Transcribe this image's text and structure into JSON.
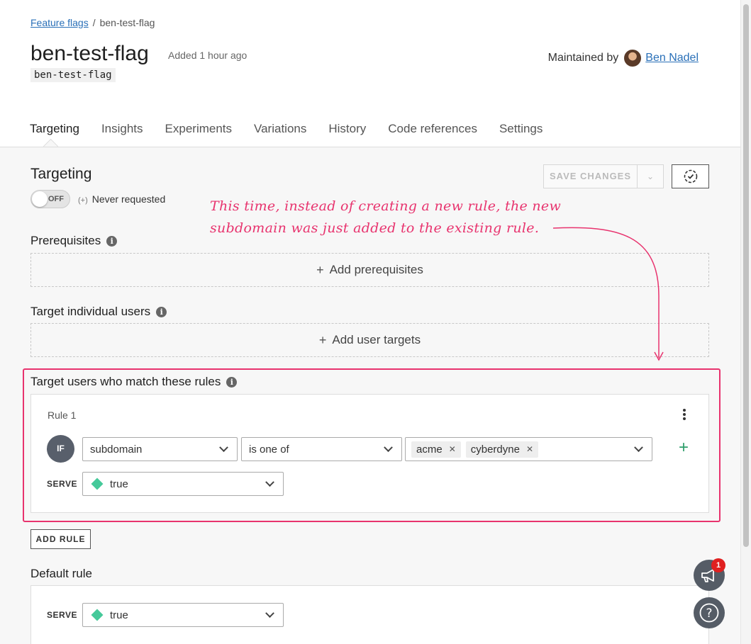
{
  "breadcrumb": {
    "parent": "Feature flags",
    "separator": "/",
    "current": "ben-test-flag"
  },
  "flag": {
    "name": "ben-test-flag",
    "added": "Added 1 hour ago",
    "key": "ben-test-flag"
  },
  "maintainer": {
    "prefix": "Maintained by",
    "name": "Ben Nadel"
  },
  "tabs": [
    {
      "label": "Targeting",
      "active": true
    },
    {
      "label": "Insights"
    },
    {
      "label": "Experiments"
    },
    {
      "label": "Variations"
    },
    {
      "label": "History"
    },
    {
      "label": "Code references"
    },
    {
      "label": "Settings"
    }
  ],
  "targeting": {
    "title": "Targeting",
    "toggle_label": "OFF",
    "toggle_on": false,
    "requested_plus": "(+)",
    "requested_text": "Never requested",
    "save_label": "SAVE CHANGES"
  },
  "prerequisites": {
    "title": "Prerequisites",
    "add_label": "Add prerequisites"
  },
  "individual": {
    "title": "Target individual users",
    "add_label": "Add user targets"
  },
  "rules": {
    "title": "Target users who match these rules",
    "rule_name": "Rule 1",
    "if_label": "IF",
    "attribute": "subdomain",
    "operator": "is one of",
    "values": [
      "acme",
      "cyberdyne"
    ],
    "serve_label": "SERVE",
    "serve_value": "true",
    "add_rule_label": "ADD RULE"
  },
  "default_rule": {
    "title": "Default rule",
    "serve_label": "SERVE",
    "serve_value": "true"
  },
  "annotation": {
    "line1": "This time, instead of creating a new rule, the new",
    "line2": "subdomain was just added to the existing rule."
  },
  "notifications": {
    "count": "1"
  },
  "colors": {
    "accent": "#e8336e",
    "link": "#2a70b8",
    "variation_true": "#45c99a",
    "add_green": "#2e9e6b"
  },
  "icons": [
    "info-icon",
    "history-check-icon",
    "kebab-menu-icon",
    "megaphone-icon",
    "help-icon",
    "plus-icon",
    "chevron-down-icon",
    "close-icon"
  ]
}
